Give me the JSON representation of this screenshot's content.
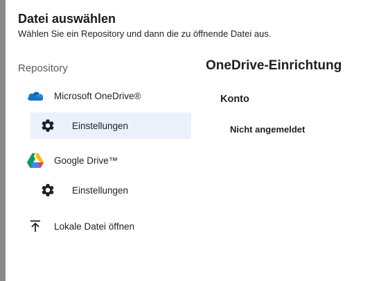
{
  "dialog": {
    "title": "Datei auswählen",
    "subtitle": "Wählen Sie ein Repository und dann die zu öffnende Datei aus."
  },
  "sidebar": {
    "heading": "Repository",
    "items": [
      {
        "label": "Microsoft OneDrive®",
        "icon": "onedrive-cloud-icon"
      },
      {
        "label": "Einstellungen",
        "icon": "gear-icon",
        "selected": true
      },
      {
        "label": "Google Drive™",
        "icon": "google-drive-icon"
      },
      {
        "label": "Einstellungen",
        "icon": "gear-icon",
        "selected": false
      },
      {
        "label": "Lokale Datei öffnen",
        "icon": "upload-icon"
      }
    ]
  },
  "main": {
    "heading": "OneDrive-Einrichtung",
    "section_title": "Konto",
    "status": "Nicht angemeldet"
  },
  "colors": {
    "selected_bg": "#eaf1fa",
    "onedrive_blue": "#1a73c8",
    "backdrop": "#6b6b6b"
  }
}
